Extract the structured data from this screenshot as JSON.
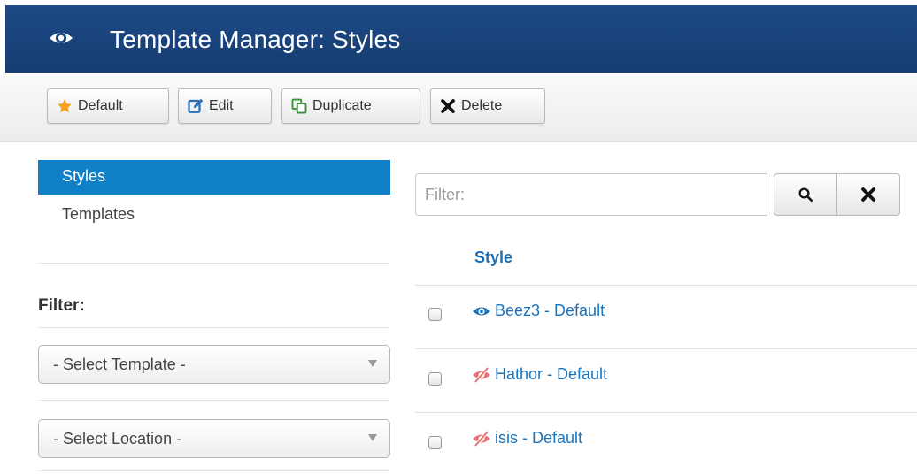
{
  "header": {
    "title": "Template Manager: Styles",
    "icon": "eye-icon"
  },
  "toolbar": {
    "default_label": "Default",
    "edit_label": "Edit",
    "duplicate_label": "Duplicate",
    "delete_label": "Delete"
  },
  "sidebar": {
    "items": [
      {
        "label": "Styles",
        "active": true
      },
      {
        "label": "Templates",
        "active": false
      }
    ],
    "filter_label": "Filter:",
    "select_template": "- Select Template -",
    "select_location": "- Select Location -"
  },
  "search": {
    "placeholder": "Filter:"
  },
  "table": {
    "column_header": "Style",
    "rows": [
      {
        "label": "Beez3 - Default",
        "is_default": true
      },
      {
        "label": "Hathor - Default",
        "is_default": false
      },
      {
        "label": "isis - Default",
        "is_default": false
      }
    ]
  },
  "colors": {
    "header_bg": "#1a4480",
    "active_nav": "#0f80c6",
    "link": "#1c74bb",
    "default_star": "#f7a21b",
    "not_default_icon": "#e57373"
  }
}
